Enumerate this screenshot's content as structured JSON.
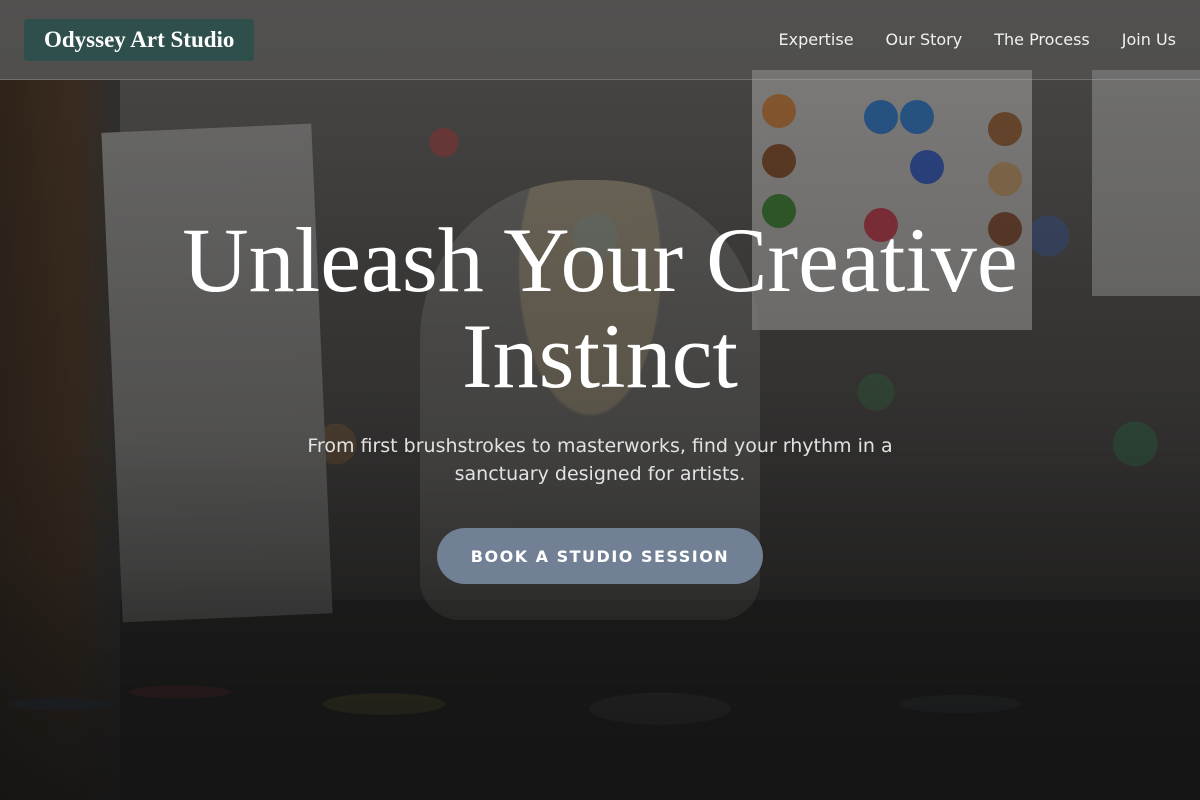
{
  "header": {
    "logo_text": "Odyssey Art Studio",
    "nav": [
      {
        "label": "Expertise"
      },
      {
        "label": "Our Story"
      },
      {
        "label": "The Process"
      },
      {
        "label": "Join Us"
      }
    ]
  },
  "hero": {
    "title": "Unleash Your Creative Instinct",
    "subtitle": "From first brushstrokes to masterworks, find your rhythm in a sanctuary designed for artists.",
    "cta_label": "BOOK A STUDIO SESSION"
  },
  "colors": {
    "logo_bg": "#2f4f4d",
    "cta_bg": "#728096",
    "text": "#ffffff"
  }
}
